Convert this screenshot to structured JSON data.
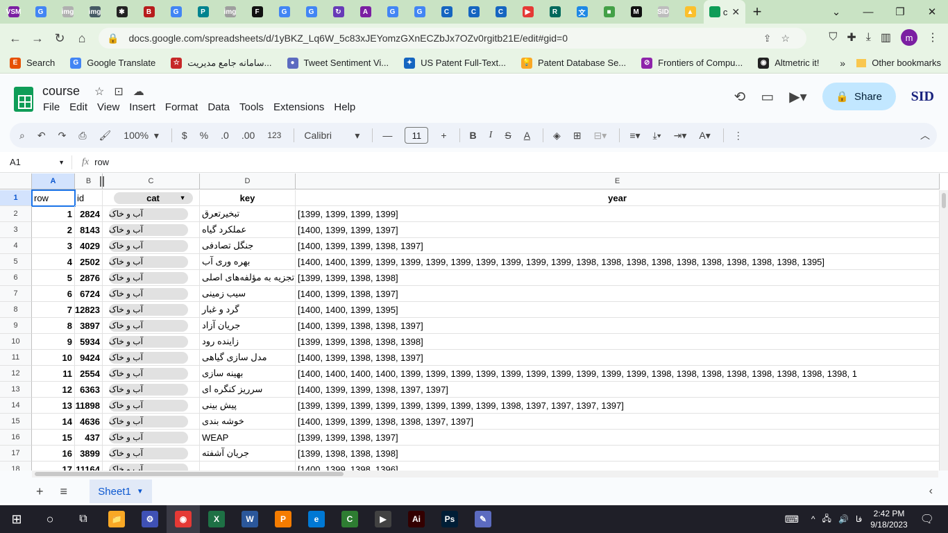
{
  "browser": {
    "tabs": [
      {
        "icon": "VSM",
        "color": "#7b1fa2"
      },
      {
        "icon": "G",
        "color": "#4285f4"
      },
      {
        "icon": "img",
        "color": "#b0b0b0"
      },
      {
        "icon": "img",
        "color": "#455a64"
      },
      {
        "icon": "✱",
        "color": "#222222"
      },
      {
        "icon": "B",
        "color": "#b71c1c"
      },
      {
        "icon": "G",
        "color": "#4285f4"
      },
      {
        "icon": "P",
        "color": "#00838f"
      },
      {
        "icon": "img",
        "color": "#9e9e9e"
      },
      {
        "icon": "F",
        "color": "#111111"
      },
      {
        "icon": "G",
        "color": "#4285f4"
      },
      {
        "icon": "G",
        "color": "#4285f4"
      },
      {
        "icon": "↻",
        "color": "#673ab7"
      },
      {
        "icon": "A",
        "color": "#7b1fa2"
      },
      {
        "icon": "G",
        "color": "#4285f4"
      },
      {
        "icon": "G",
        "color": "#4285f4"
      },
      {
        "icon": "C",
        "color": "#1565c0"
      },
      {
        "icon": "C",
        "color": "#1565c0"
      },
      {
        "icon": "C",
        "color": "#1565c0"
      },
      {
        "icon": "▶",
        "color": "#e53935"
      },
      {
        "icon": "R",
        "color": "#00695c"
      },
      {
        "icon": "文",
        "color": "#1e88e5"
      },
      {
        "icon": "■",
        "color": "#43a047"
      },
      {
        "icon": "M",
        "color": "#111111"
      },
      {
        "icon": "SID",
        "color": "#bdbdbd"
      },
      {
        "icon": "▲",
        "color": "#fbc02d"
      }
    ],
    "active_tab": {
      "label": "c",
      "close": "✕"
    },
    "new_tab": "+",
    "url": "docs.google.com/spreadsheets/d/1yBKZ_Lq6W_5c83xJEYomzGXnECZbJx7OZv0rgitb21E/edit#gid=0",
    "profile_initial": "m",
    "bookmarks": [
      {
        "label": "Search",
        "icon": "E",
        "color": "#e65100"
      },
      {
        "label": "Google Translate",
        "icon": "G",
        "color": "#4285f4"
      },
      {
        "label": "سامانه جامع مدیریت...",
        "icon": "☆",
        "color": "#c62828"
      },
      {
        "label": "Tweet Sentiment Vi...",
        "icon": "●",
        "color": "#5c6bc0"
      },
      {
        "label": "US Patent Full-Text...",
        "icon": "✦",
        "color": "#1565c0"
      },
      {
        "label": "Patent Database Se...",
        "icon": "💡",
        "color": "#f9a825"
      },
      {
        "label": "Frontiers of Compu...",
        "icon": "⊘",
        "color": "#8e24aa"
      },
      {
        "label": "Altmetric it!",
        "icon": "◉",
        "color": "#222222"
      }
    ],
    "bookmarks_more": "»",
    "other_bookmarks": "Other bookmarks"
  },
  "doc": {
    "title": "course",
    "menu": [
      "File",
      "Edit",
      "View",
      "Insert",
      "Format",
      "Data",
      "Tools",
      "Extensions",
      "Help"
    ],
    "share_label": "Share",
    "brand": "SID"
  },
  "toolbar": {
    "zoom": "100%",
    "currency": "$",
    "percent": "%",
    "dec_less": ".0",
    "dec_more": ".00",
    "number_format": "123",
    "font": "Calibri",
    "font_size": "11"
  },
  "formula_bar": {
    "cell_ref": "A1",
    "fx": "fx",
    "value": "row"
  },
  "columns": [
    {
      "letter": "A",
      "header": "row"
    },
    {
      "letter": "B",
      "header": "id"
    },
    {
      "letter": "C",
      "header": "cat"
    },
    {
      "letter": "D",
      "header": "key"
    },
    {
      "letter": "E",
      "header": "year"
    }
  ],
  "rows": [
    {
      "n": "1",
      "row": "",
      "id": "",
      "cat": "",
      "key": "",
      "year": ""
    },
    {
      "n": "2",
      "row": "1",
      "id": "2824",
      "cat": "آب و خاک",
      "key": "تبخیرتعرق",
      "year": "[1399, 1399, 1399, 1399]"
    },
    {
      "n": "3",
      "row": "2",
      "id": "8143",
      "cat": "آب و خاک",
      "key": "عملکرد گیاه",
      "year": "[1400, 1399, 1399, 1397]"
    },
    {
      "n": "4",
      "row": "3",
      "id": "4029",
      "cat": "آب و خاک",
      "key": "جنگل تصادفی",
      "year": "[1400, 1399, 1399, 1398, 1397]"
    },
    {
      "n": "5",
      "row": "4",
      "id": "2502",
      "cat": "آب و خاک",
      "key": "بهره وری آب",
      "year": "[1400, 1400, 1399, 1399, 1399, 1399, 1399, 1399, 1399, 1399, 1399, 1398, 1398, 1398, 1398, 1398, 1398, 1398, 1398, 1398, 1395]"
    },
    {
      "n": "6",
      "row": "5",
      "id": "2876",
      "cat": "آب و خاک",
      "key": "تجزیه به مؤلفه‌های اصلی",
      "year": "[1399, 1399, 1398, 1398]"
    },
    {
      "n": "7",
      "row": "6",
      "id": "6724",
      "cat": "آب و خاک",
      "key": "سیب زمینی",
      "year": "[1400, 1399, 1398, 1397]"
    },
    {
      "n": "8",
      "row": "7",
      "id": "12823",
      "cat": "آب و خاک",
      "key": "گرد و غبار",
      "year": "[1400, 1400, 1399, 1395]"
    },
    {
      "n": "9",
      "row": "8",
      "id": "3897",
      "cat": "آب و خاک",
      "key": "جریان آزاد",
      "year": "[1400, 1399, 1398, 1398, 1397]"
    },
    {
      "n": "10",
      "row": "9",
      "id": "5934",
      "cat": "آب و خاک",
      "key": "زاینده رود",
      "year": "[1399, 1399, 1398, 1398, 1398]"
    },
    {
      "n": "11",
      "row": "10",
      "id": "9424",
      "cat": "آب و خاک",
      "key": "مدل سازی گیاهی",
      "year": "[1400, 1399, 1398, 1398, 1397]"
    },
    {
      "n": "12",
      "row": "11",
      "id": "2554",
      "cat": "آب و خاک",
      "key": "بهینه سازی",
      "year": "[1400, 1400, 1400, 1400, 1399, 1399, 1399, 1399, 1399, 1399, 1399, 1399, 1399, 1399, 1398, 1398, 1398, 1398, 1398, 1398, 1398, 1398, 1"
    },
    {
      "n": "13",
      "row": "12",
      "id": "6363",
      "cat": "آب و خاک",
      "key": "سرریز کنگره ای",
      "year": "[1400, 1399, 1399, 1398, 1397, 1397]"
    },
    {
      "n": "14",
      "row": "13",
      "id": "11898",
      "cat": "آب و خاک",
      "key": "پیش بینی",
      "year": "[1399, 1399, 1399, 1399, 1399, 1399, 1399, 1399, 1398, 1397, 1397, 1397, 1397]"
    },
    {
      "n": "15",
      "row": "14",
      "id": "4636",
      "cat": "آب و خاک",
      "key": "خوشه بندی",
      "year": "[1400, 1399, 1399, 1398, 1398, 1397, 1397]"
    },
    {
      "n": "16",
      "row": "15",
      "id": "437",
      "cat": "آب و خاک",
      "key": "WEAP",
      "year": "[1399, 1399, 1398, 1397]"
    },
    {
      "n": "17",
      "row": "16",
      "id": "3899",
      "cat": "آب و خاک",
      "key": "جریان آشفته",
      "year": "[1399, 1398, 1398, 1398]"
    },
    {
      "n": "18",
      "row": "17",
      "id": "11164",
      "cat": "آب و خاک",
      "key": "",
      "year": "[1400, 1399, 1398, 1396]"
    }
  ],
  "sheets": {
    "add": "+",
    "list": "≡",
    "active": "Sheet1"
  },
  "taskbar": {
    "apps": [
      {
        "icon": "📁",
        "color": "#f9a825"
      },
      {
        "icon": "⚙",
        "color": "#3f51b5"
      },
      {
        "icon": "◉",
        "color": "#e53935"
      },
      {
        "icon": "X",
        "color": "#1e7145"
      },
      {
        "icon": "W",
        "color": "#2b579a"
      },
      {
        "icon": "P",
        "color": "#f57c00"
      },
      {
        "icon": "e",
        "color": "#0078d4"
      },
      {
        "icon": "C",
        "color": "#2e7d32"
      },
      {
        "icon": "▶",
        "color": "#424242"
      },
      {
        "icon": "Ai",
        "color": "#330000"
      },
      {
        "icon": "Ps",
        "color": "#001e36"
      },
      {
        "icon": "✎",
        "color": "#5c6bc0"
      }
    ],
    "lang": "فا",
    "time": "2:42 PM",
    "date": "9/18/2023"
  }
}
